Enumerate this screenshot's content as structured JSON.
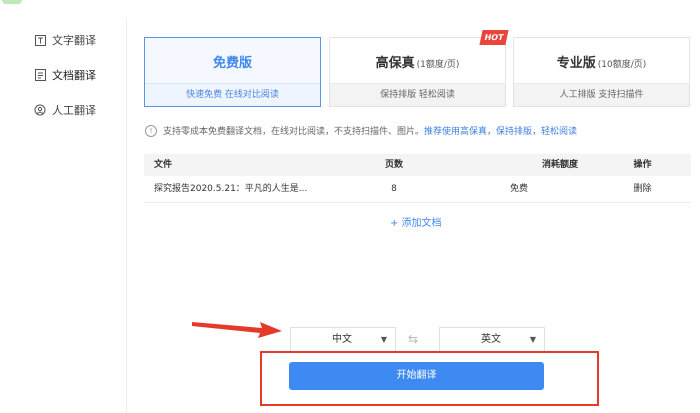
{
  "sidebar": {
    "items": [
      {
        "label": "文字翻译",
        "icon": "text-t-icon"
      },
      {
        "label": "文档翻译",
        "icon": "document-icon"
      },
      {
        "label": "人工翻译",
        "icon": "person-icon"
      }
    ]
  },
  "plans": [
    {
      "title": "免费版",
      "sub": "",
      "desc": "快速免费 在线对比阅读"
    },
    {
      "title": "高保真",
      "sub": "(1额度/页)",
      "desc": "保持排版 轻松阅读",
      "badge": "HOT"
    },
    {
      "title": "专业版",
      "sub": "(10额度/页)",
      "desc": "人工排版 支持扫描件"
    }
  ],
  "notice": {
    "text": "支持零成本免费翻译文档，在线对比阅读，不支持扫描件、图片。",
    "link": "推荐使用高保真，保持排版，轻松阅读"
  },
  "table": {
    "headers": [
      "文件",
      "页数",
      "消耗额度",
      "操作"
    ],
    "rows": [
      {
        "file": "探究报告2020.5.21：平凡的人生是...",
        "pages": "8",
        "cost": "免费",
        "action": "删除"
      }
    ]
  },
  "add_doc": "+ 添加文档",
  "lang": {
    "source": "中文",
    "target": "英文",
    "swap": "⇆"
  },
  "start_button": "开始翻译",
  "colors": {
    "accent": "#3d8bf2",
    "annotation_red": "#e53a2a"
  }
}
